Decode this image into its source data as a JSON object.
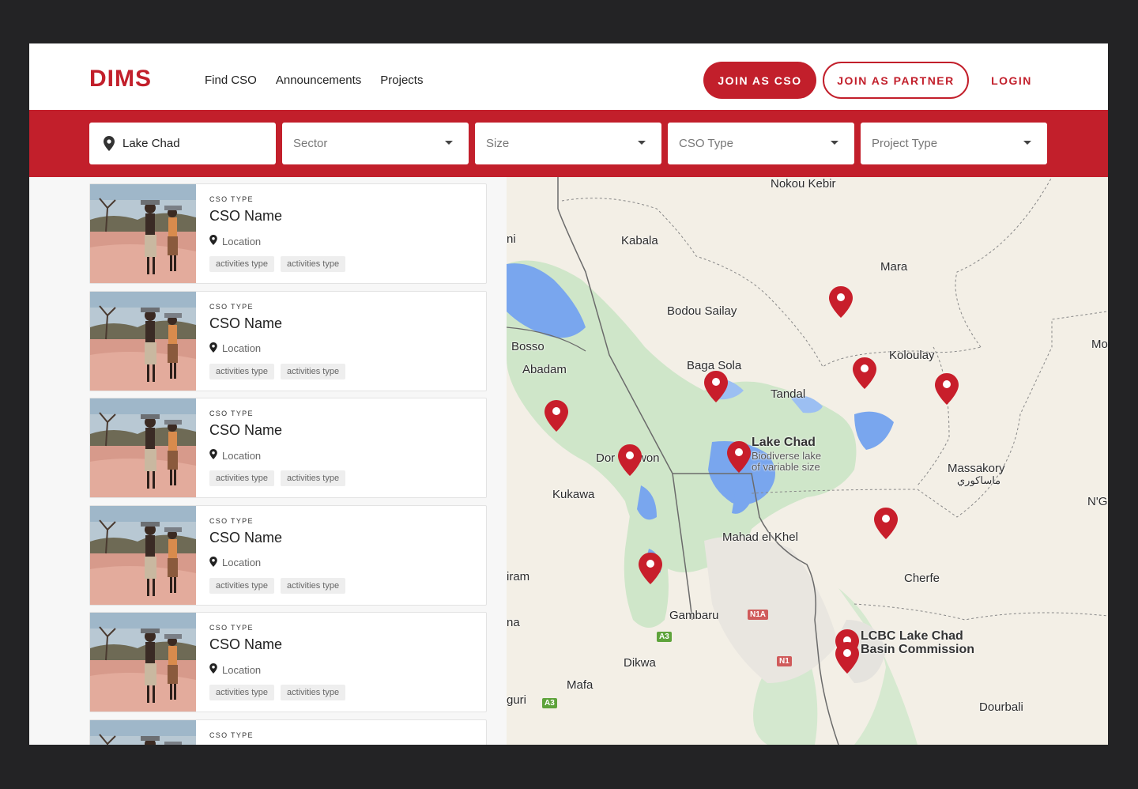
{
  "brand": {
    "logo": "DIMS",
    "accent": "#c21f2b"
  },
  "nav": [
    {
      "label": "Find CSO"
    },
    {
      "label": "Announcements"
    },
    {
      "label": "Projects"
    }
  ],
  "actions": {
    "join_cso": "JOIN AS CSO",
    "join_partner": "JOIN AS PARTNER",
    "login": "LOGIN"
  },
  "filters": {
    "location_value": "Lake Chad",
    "sector": "Sector",
    "size": "Size",
    "cso_type": "CSO Type",
    "project_type": "Project Type"
  },
  "cards": [
    {
      "type": "CSO TYPE",
      "name": "CSO Name",
      "location": "Location",
      "tags": [
        "activities type",
        "activities type"
      ]
    },
    {
      "type": "CSO TYPE",
      "name": "CSO Name",
      "location": "Location",
      "tags": [
        "activities type",
        "activities type"
      ]
    },
    {
      "type": "CSO TYPE",
      "name": "CSO Name",
      "location": "Location",
      "tags": [
        "activities type",
        "activities type"
      ]
    },
    {
      "type": "CSO TYPE",
      "name": "CSO Name",
      "location": "Location",
      "tags": [
        "activities type",
        "activities type"
      ]
    },
    {
      "type": "CSO TYPE",
      "name": "CSO Name",
      "location": "Location",
      "tags": [
        "activities type",
        "activities type"
      ]
    },
    {
      "type": "CSO TYPE",
      "name": "",
      "location": "",
      "tags": []
    }
  ],
  "map": {
    "labels": [
      "Nokou Kebir",
      "Kabala",
      "Mara",
      "Bodou Sailay",
      "Bosso",
      "Abadam",
      "Baga Sola",
      "Tandal",
      "Koloulay",
      "Mo",
      "Kukawa",
      "Massakory",
      "ماساكوري",
      "N'G",
      "Mahad el Khel",
      "iram",
      "Cherfe",
      "Gambaru",
      "Dikwa",
      "Mafa",
      "guri",
      "Dourbali",
      "ni",
      "na",
      "Dor",
      "won"
    ],
    "lake_title": "Lake Chad",
    "lake_sub1": "Biodiverse lake",
    "lake_sub2": "of variable size",
    "lcbc_line1": "LCBC Lake Chad",
    "lcbc_line2": "Basin Commission",
    "roads": [
      "N1A",
      "A3",
      "N1",
      "A3"
    ]
  }
}
